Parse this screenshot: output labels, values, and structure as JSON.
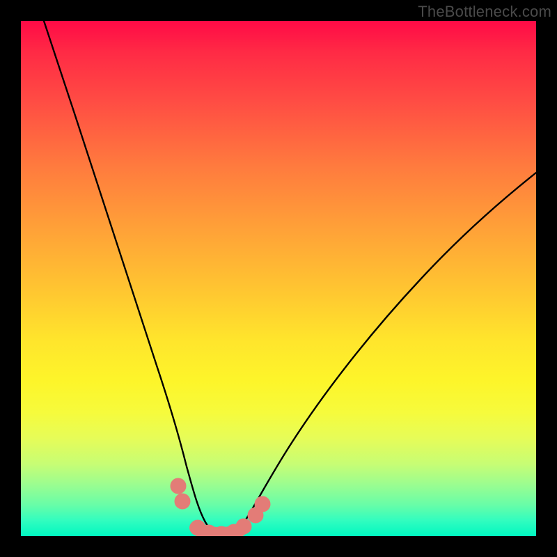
{
  "watermark": "TheBottleneck.com",
  "colors": {
    "frame": "#000000",
    "curve": "#000000",
    "beads": "#e37c77",
    "gradient_top": "#ff0a46",
    "gradient_bottom": "#00f7c1"
  },
  "chart_data": {
    "type": "line",
    "title": "",
    "xlabel": "",
    "ylabel": "",
    "xlim": [
      0,
      1
    ],
    "ylim": [
      0,
      1
    ],
    "note": "Axes are implicit (no ticks/labels rendered). x is normalized left→right across the gradient square, y is normalized bottom→top (0 = bottom green band, 1 = top red band). The single black curve is a V-shaped bottleneck curve; values below are read off pixel positions.",
    "series": [
      {
        "name": "bottleneck-curve",
        "x": [
          0.045,
          0.1,
          0.15,
          0.2,
          0.235,
          0.27,
          0.29,
          0.305,
          0.32,
          0.335,
          0.355,
          0.38,
          0.405,
          0.43,
          0.455,
          0.5,
          0.55,
          0.6,
          0.65,
          0.7,
          0.75,
          0.8,
          0.85,
          0.9,
          0.95,
          1.0
        ],
        "y": [
          1.0,
          0.8,
          0.62,
          0.45,
          0.32,
          0.2,
          0.14,
          0.095,
          0.055,
          0.028,
          0.01,
          0.003,
          0.003,
          0.01,
          0.028,
          0.075,
          0.14,
          0.205,
          0.27,
          0.335,
          0.395,
          0.45,
          0.505,
          0.555,
          0.6,
          0.645
        ]
      }
    ],
    "markers": {
      "name": "salmon-beads",
      "description": "Cluster of salmon-colored round markers along the bottom of the V and two on each slope above the trough.",
      "points_xy": [
        [
          0.305,
          0.095
        ],
        [
          0.315,
          0.065
        ],
        [
          0.345,
          0.012
        ],
        [
          0.365,
          0.006
        ],
        [
          0.39,
          0.004
        ],
        [
          0.415,
          0.006
        ],
        [
          0.435,
          0.012
        ],
        [
          0.455,
          0.035
        ],
        [
          0.47,
          0.058
        ]
      ]
    }
  }
}
